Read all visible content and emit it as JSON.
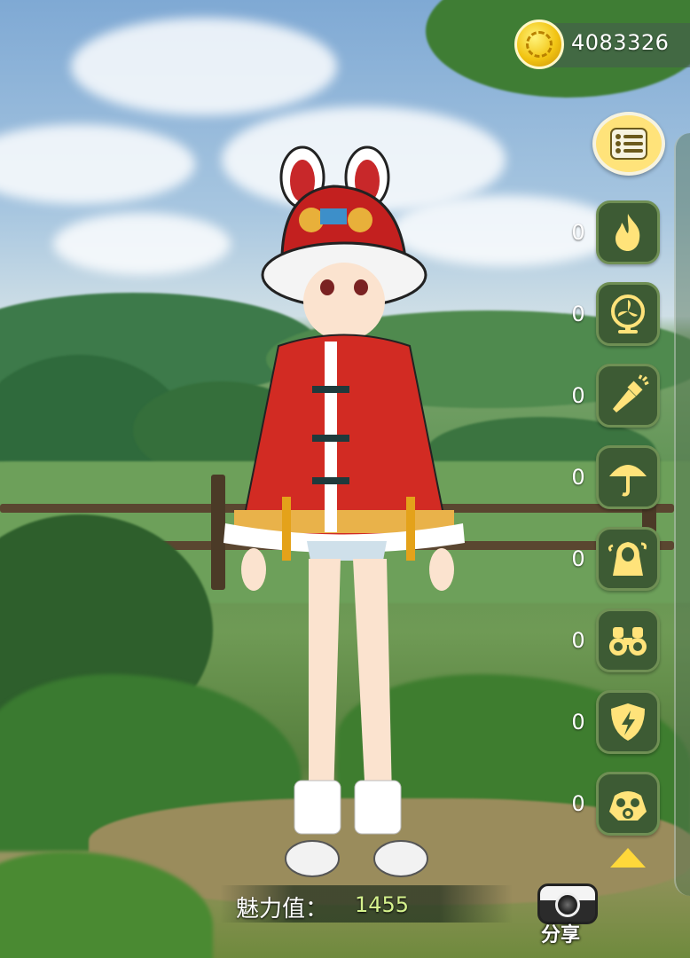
{
  "hud": {
    "coins": "4083326"
  },
  "sidebar": {
    "menu_icon": "list-icon",
    "tools": [
      {
        "name": "fire",
        "icon": "fire-icon",
        "count": "0"
      },
      {
        "name": "fan",
        "icon": "fan-icon",
        "count": "0"
      },
      {
        "name": "flashlight",
        "icon": "flashlight-icon",
        "count": "0"
      },
      {
        "name": "umbrella",
        "icon": "umbrella-icon",
        "count": "0"
      },
      {
        "name": "raincoat",
        "icon": "raincoat-icon",
        "count": "0"
      },
      {
        "name": "binoculars",
        "icon": "binoculars-icon",
        "count": "0"
      },
      {
        "name": "lightning-shield",
        "icon": "lightning-shield-icon",
        "count": "0"
      },
      {
        "name": "gas-mask",
        "icon": "gas-mask-icon",
        "count": "0"
      }
    ],
    "scroll_icon": "triangle-up-icon"
  },
  "charm": {
    "label": "魅力值：",
    "value": "1455"
  },
  "share": {
    "label": "分享",
    "icon": "camera-icon"
  },
  "colors": {
    "accent_yellow": "#ffe37a",
    "tool_bg": "#3d5b34",
    "charm_value": "#d5f28d"
  }
}
